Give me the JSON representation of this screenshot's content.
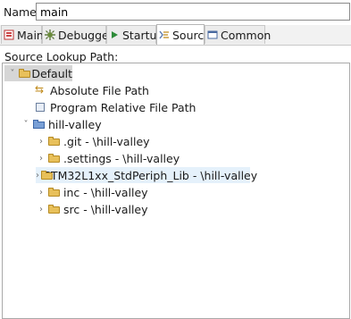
{
  "name_row": {
    "label": "Name:",
    "value": "main"
  },
  "tabs": [
    {
      "label": "Main",
      "icon": "main-icon"
    },
    {
      "label": "Debugger",
      "icon": "debugger-icon"
    },
    {
      "label": "Startup",
      "icon": "startup-icon"
    },
    {
      "label": "Source",
      "icon": "source-icon",
      "active": true
    },
    {
      "label": "Common",
      "icon": "common-icon"
    }
  ],
  "source": {
    "section_label": "Source Lookup Path:",
    "tree": [
      {
        "label": "Default",
        "twisty": "˅",
        "icon": "default-folder-icon",
        "state": "selected"
      },
      {
        "label": "Absolute File Path",
        "icon": "absolute-path-icon"
      },
      {
        "label": "Program Relative File Path",
        "icon": "relative-path-icon"
      },
      {
        "label": "hill-valley",
        "twisty": "˅",
        "icon": "project-folder-icon"
      },
      {
        "label": ".git - \\hill-valley",
        "twisty": "›",
        "icon": "folder-icon"
      },
      {
        "label": ".settings - \\hill-valley",
        "twisty": "›",
        "icon": "folder-icon"
      },
      {
        "label": "STM32L1xx_StdPeriph_Lib - \\hill-valley",
        "twisty": "›",
        "icon": "folder-icon",
        "state": "hover"
      },
      {
        "label": "inc - \\hill-valley",
        "twisty": "›",
        "icon": "folder-icon"
      },
      {
        "label": "src - \\hill-valley",
        "twisty": "›",
        "icon": "folder-icon"
      }
    ]
  },
  "colors": {
    "tab_bar": "#f2f2f2",
    "selection": "#d6d6d6",
    "hover": "#e5f1fb",
    "folder": "#e8c05a"
  }
}
